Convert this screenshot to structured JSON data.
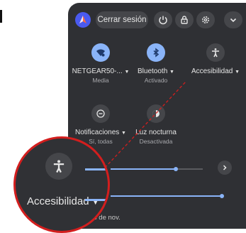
{
  "topbar": {
    "signout_label": "Cerrar sesión"
  },
  "tiles": [
    {
      "label": "NETGEAR50-...",
      "sub": "Media",
      "active": true,
      "icon": "wifi-icon"
    },
    {
      "label": "Bluetooth",
      "sub": "Activado",
      "active": true,
      "icon": "bluetooth-icon"
    },
    {
      "label": "Accesibilidad",
      "sub": "",
      "active": false,
      "icon": "accessibility-icon"
    },
    {
      "label": "Notificaciones",
      "sub": "Sí, todas",
      "active": false,
      "icon": "notifications-icon"
    },
    {
      "label": "Luz nocturna",
      "sub": "Desactivada",
      "active": false,
      "icon": "night-light-icon"
    }
  ],
  "sliders": {
    "volume_level": 0.73,
    "brightness_level": 0.97
  },
  "date": {
    "text": "s 3 de nov."
  },
  "magnifier": {
    "label": "Accesibilidad"
  },
  "colors": {
    "panel_bg": "#2f3034",
    "accent": "#8ab4f8",
    "highlight": "#d31e1e"
  }
}
